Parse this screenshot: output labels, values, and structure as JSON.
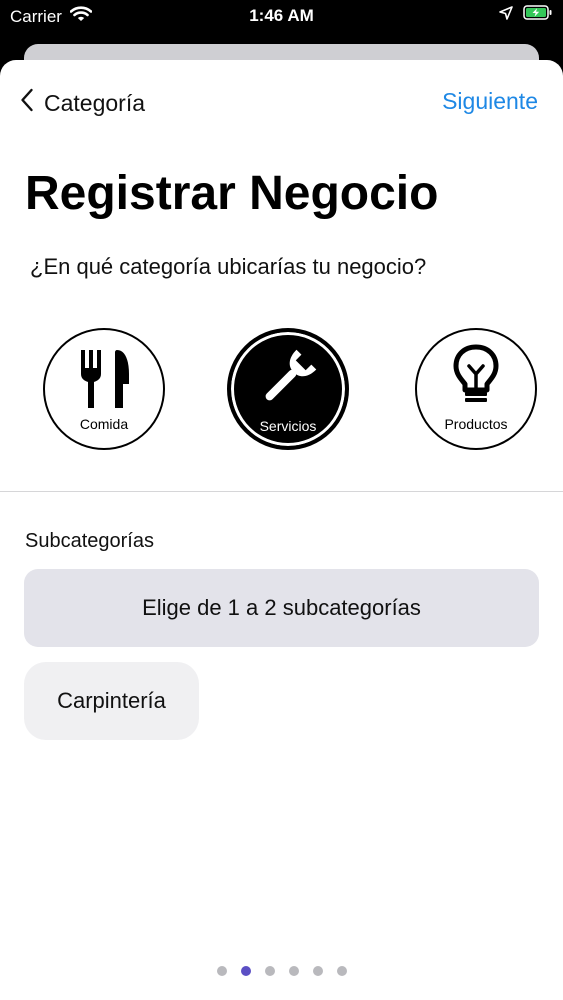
{
  "status_bar": {
    "carrier": "Carrier",
    "time": "1:46 AM",
    "battery_color": "#34c759"
  },
  "nav": {
    "back_label": "Categoría",
    "next_label": "Siguiente",
    "accent": "#1e88e5"
  },
  "page": {
    "title": "Registrar Negocio",
    "question": "¿En qué categoría ubicarías tu negocio?"
  },
  "categories": [
    {
      "label": "Comida",
      "icon": "fork-knife-icon",
      "selected": false
    },
    {
      "label": "Servicios",
      "icon": "wrench-icon",
      "selected": true
    },
    {
      "label": "Productos",
      "icon": "lightbulb-icon",
      "selected": false
    }
  ],
  "subcategories": {
    "heading": "Subcategorías",
    "hint": "Elige de 1 a 2 subcategorías",
    "items": [
      "Carpintería"
    ]
  },
  "pager": {
    "count": 6,
    "active_index": 1,
    "active_color": "#5b4fc4"
  }
}
